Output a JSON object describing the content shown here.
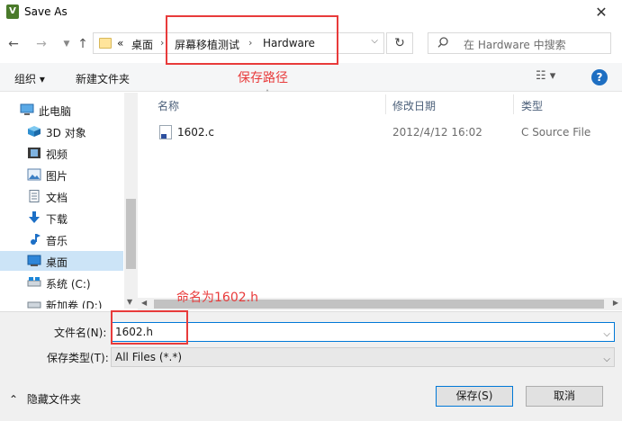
{
  "window": {
    "title": "Save As",
    "close_glyph": "✕"
  },
  "nav": {
    "back_glyph": "←",
    "forward_glyph": "→",
    "up_glyph": "↑",
    "refresh_glyph": "↻",
    "breadcrumb_overflow": "«",
    "breadcrumbs": [
      "桌面",
      "屏幕移植测试",
      "Hardware"
    ],
    "search_placeholder": "在 Hardware 中搜索"
  },
  "toolbar": {
    "organize": "组织 ▾",
    "new_folder": "新建文件夹",
    "view_glyph": "☷ ▾",
    "help": "?"
  },
  "sidebar": {
    "items": [
      {
        "label": "此电脑",
        "icon": "computer-icon"
      },
      {
        "label": "3D 对象",
        "icon": "cube-icon"
      },
      {
        "label": "视频",
        "icon": "video-icon"
      },
      {
        "label": "图片",
        "icon": "picture-icon"
      },
      {
        "label": "文档",
        "icon": "document-icon"
      },
      {
        "label": "下载",
        "icon": "download-icon"
      },
      {
        "label": "音乐",
        "icon": "music-icon"
      },
      {
        "label": "桌面",
        "icon": "desktop-icon",
        "selected": true
      },
      {
        "label": "系统 (C:)",
        "icon": "drive-icon"
      },
      {
        "label": "新加卷 (D:)",
        "icon": "drive-icon"
      }
    ]
  },
  "file_list": {
    "columns": [
      "名称",
      "修改日期",
      "类型"
    ],
    "rows": [
      {
        "name": "1602.c",
        "modified": "2012/4/12 16:02",
        "type": "C Source File"
      }
    ]
  },
  "form": {
    "filename_label": "文件名(N):",
    "filename_value": "1602.h",
    "filetype_label": "保存类型(T):",
    "filetype_value": "All Files (*.*)",
    "hide_folders": "隐藏文件夹",
    "save_button": "保存(S)",
    "cancel_button": "取消"
  },
  "annotations": {
    "path_label": "保存路径",
    "name_label": "命名为1602.h",
    "color": "#e83b3b"
  },
  "colors": {
    "accent": "#0078d7",
    "selected": "#cce4f7"
  }
}
